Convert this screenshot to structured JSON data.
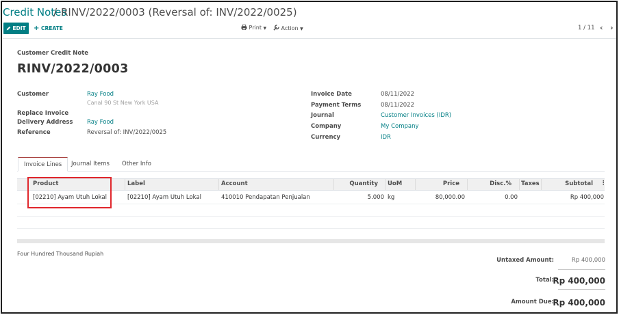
{
  "breadcrumb": {
    "parent": "Credit Notes",
    "separator": "/",
    "current": "RINV/2022/0003 (Reversal of: INV/2022/0025)"
  },
  "toolbar": {
    "edit_label": "EDIT",
    "create_label": "CREATE",
    "print_label": "Print",
    "action_label": "Action"
  },
  "pager": {
    "value": "1 / 11",
    "prev_icon": "chevron-left-icon",
    "next_icon": "chevron-right-icon"
  },
  "document": {
    "type": "Customer Credit Note",
    "name": "RINV/2022/0003"
  },
  "left_fields": {
    "customer_label": "Customer",
    "customer_value": "Ray Food",
    "customer_address": "Canal 90 St New York USA",
    "replace_invoice_label": "Replace Invoice",
    "delivery_address_label": "Delivery Address",
    "delivery_address_value": "Ray Food",
    "reference_label": "Reference",
    "reference_value": "Reversal of: INV/2022/0025"
  },
  "right_fields": {
    "invoice_date_label": "Invoice Date",
    "invoice_date_value": "08/11/2022",
    "payment_terms_label": "Payment Terms",
    "payment_terms_value": "08/11/2022",
    "journal_label": "Journal",
    "journal_value": "Customer Invoices (IDR)",
    "company_label": "Company",
    "company_value": "My Company",
    "currency_label": "Currency",
    "currency_value": "IDR"
  },
  "tabs": [
    "Invoice Lines",
    "Journal Items",
    "Other Info"
  ],
  "lines_table": {
    "columns": [
      "Product",
      "Label",
      "Account",
      "Quantity",
      "UoM",
      "Price",
      "Disc.%",
      "Taxes",
      "Subtotal"
    ],
    "rows": [
      {
        "product": "[02210] Ayam Utuh Lokal",
        "label": "[02210] Ayam Utuh Lokal",
        "account": "410010 Pendapatan Penjualan",
        "quantity": "5.000",
        "uom": "kg",
        "price": "80,000.00",
        "discount": "0.00",
        "taxes": "",
        "subtotal": "Rp 400,000"
      }
    ]
  },
  "amount_in_words": "Four Hundred Thousand Rupiah",
  "totals": {
    "untaxed_label": "Untaxed Amount:",
    "untaxed_value": "Rp 400,000",
    "total_label": "Total:",
    "total_value": "Rp 400,000",
    "amount_due_label": "Amount Due:",
    "amount_due_value": "Rp 400,000"
  },
  "colors": {
    "accent": "#017e84",
    "highlight_box": "#e0262b"
  }
}
